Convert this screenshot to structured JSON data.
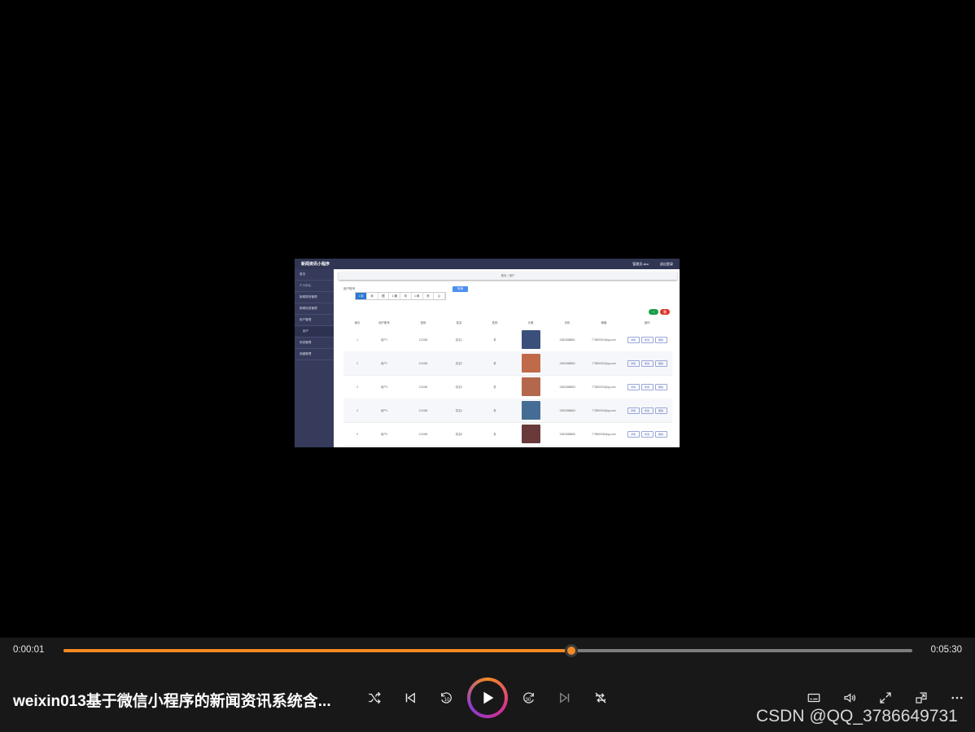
{
  "video_frame": {
    "brand": "新闻资讯小程序",
    "user_label": "管理员 abo",
    "logout": "退出登录",
    "sidebar": [
      "首页",
      "个人中心",
      "新闻类别管理",
      "新闻信息管理",
      "用户管理",
      "用户",
      "系统管理",
      "收藏管理"
    ],
    "breadcrumb": "首页 / 用户",
    "search_label": "用户账号",
    "search_button": "查询",
    "toolbar": [
      "1 用",
      "永",
      "图",
      "1 通",
      "均",
      "1 网",
      "凉",
      "Q"
    ],
    "add_button": "+",
    "delete_button": "删",
    "columns": [
      "",
      "索引",
      "用户账号",
      "密码",
      "姓名",
      "性别",
      "头像",
      "手机",
      "邮箱",
      "操作"
    ],
    "rows": [
      {
        "index": "1",
        "account": "用户1",
        "password": "123456",
        "name": "姓名1",
        "gender": "男",
        "phone": "13823888881",
        "email": "773890001@qq.com",
        "avatar_color": "#3a4f7a"
      },
      {
        "index": "2",
        "account": "用户2",
        "password": "123456",
        "name": "姓名2",
        "gender": "男",
        "phone": "13823888882",
        "email": "773890002@qq.com",
        "avatar_color": "#c06a4a"
      },
      {
        "index": "3",
        "account": "用户3",
        "password": "123456",
        "name": "姓名3",
        "gender": "男",
        "phone": "13823888883",
        "email": "773890003@qq.com",
        "avatar_color": "#b3684e"
      },
      {
        "index": "4",
        "account": "用户4",
        "password": "123456",
        "name": "姓名4",
        "gender": "男",
        "phone": "13823888884",
        "email": "773890004@qq.com",
        "avatar_color": "#456c95"
      },
      {
        "index": "5",
        "account": "用户5",
        "password": "123456",
        "name": "姓名5",
        "gender": "男",
        "phone": "13823888885",
        "email": "773890005@qq.com",
        "avatar_color": "#6a3a3a"
      }
    ],
    "row_actions": [
      "详情",
      "修改",
      "删除"
    ]
  },
  "player": {
    "current_time": "0:00:01",
    "duration": "0:05:30",
    "progress": 0.598,
    "title": "weixin013基于微信小程序的新闻资讯系统含...",
    "accent": "#f38a24"
  },
  "watermark": "CSDN @QQ_3786649731"
}
